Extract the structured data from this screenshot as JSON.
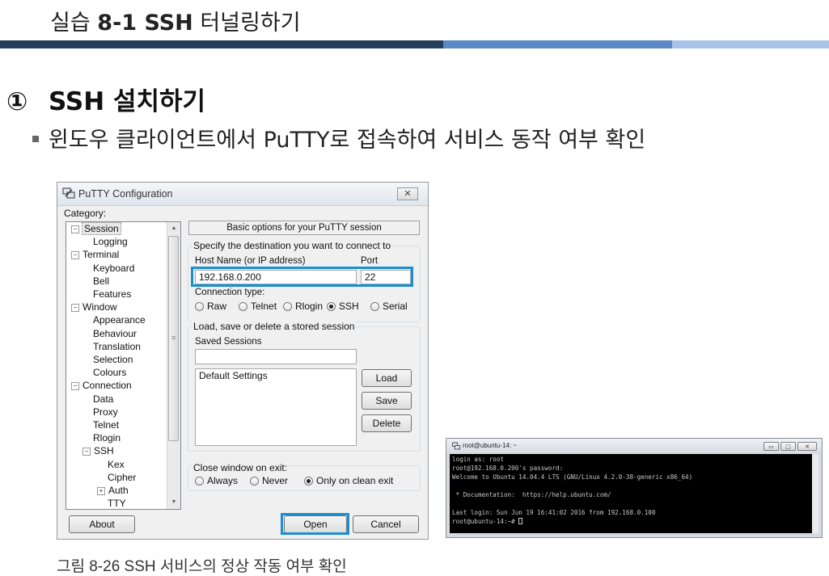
{
  "slide": {
    "title_prefix": "실습",
    "title_bold": "8-1 SSH",
    "title_suffix": "터널링하기",
    "section_number": "①",
    "section_title": "SSH 설치하기",
    "bullet": "윈도우 클라이언트에서 PuTTY로 접속하여 서비스 동작 여부 확인",
    "caption": "그림 8-26 SSH 서비스의 정상 작동 여부 확인",
    "bar_colors": [
      "#243f5e",
      "#5b88c6",
      "#a9c3e8"
    ]
  },
  "putty": {
    "title": "PuTTY Configuration",
    "close_label": "✕",
    "category_label": "Category:",
    "tree": [
      {
        "label": "Session",
        "level": 0,
        "expander": "−",
        "selected": true
      },
      {
        "label": "Logging",
        "level": 1
      },
      {
        "label": "Terminal",
        "level": 0,
        "expander": "−"
      },
      {
        "label": "Keyboard",
        "level": 1
      },
      {
        "label": "Bell",
        "level": 1
      },
      {
        "label": "Features",
        "level": 1
      },
      {
        "label": "Window",
        "level": 0,
        "expander": "−"
      },
      {
        "label": "Appearance",
        "level": 1
      },
      {
        "label": "Behaviour",
        "level": 1
      },
      {
        "label": "Translation",
        "level": 1
      },
      {
        "label": "Selection",
        "level": 1
      },
      {
        "label": "Colours",
        "level": 1
      },
      {
        "label": "Connection",
        "level": 0,
        "expander": "−"
      },
      {
        "label": "Data",
        "level": 1
      },
      {
        "label": "Proxy",
        "level": 1
      },
      {
        "label": "Telnet",
        "level": 1
      },
      {
        "label": "Rlogin",
        "level": 1
      },
      {
        "label": "SSH",
        "level": 1,
        "expander": "−"
      },
      {
        "label": "Kex",
        "level": 2
      },
      {
        "label": "Cipher",
        "level": 2
      },
      {
        "label": "Auth",
        "level": 2,
        "expander": "+"
      },
      {
        "label": "TTY",
        "level": 2
      }
    ],
    "panel_header": "Basic options for your PuTTY session",
    "destination_group": "Specify the destination you want to connect to",
    "host_label": "Host Name (or IP address)",
    "port_label": "Port",
    "host_value": "192.168.0.200",
    "port_value": "22",
    "conn_type_label": "Connection type:",
    "conn_types": [
      {
        "label": "Raw",
        "selected": false
      },
      {
        "label": "Telnet",
        "selected": false
      },
      {
        "label": "Rlogin",
        "selected": false
      },
      {
        "label": "SSH",
        "selected": true
      },
      {
        "label": "Serial",
        "selected": false
      }
    ],
    "sessions_group": "Load, save or delete a stored session",
    "saved_sessions_label": "Saved Sessions",
    "saved_sessions_value": "",
    "sessions_list": [
      "Default Settings"
    ],
    "load_label": "Load",
    "save_label": "Save",
    "delete_label": "Delete",
    "close_group": "Close window on exit:",
    "close_options": [
      {
        "label": "Always",
        "selected": false
      },
      {
        "label": "Never",
        "selected": false
      },
      {
        "label": "Only on clean exit",
        "selected": true
      }
    ],
    "about_label": "About",
    "open_label": "Open",
    "cancel_label": "Cancel",
    "highlight_color": "#1c8fd1"
  },
  "terminal": {
    "title": "root@ubuntu-14: ~",
    "lines": [
      "login as: root",
      "root@192.168.0.200's password:",
      "Welcome to Ubuntu 14.04.4 LTS (GNU/Linux 4.2.0-38-generic x86_64)",
      "",
      " * Documentation:  https://help.ubuntu.com/",
      "",
      "Last login: Sun Jun 19 16:41:02 2016 from 192.168.0.100",
      "root@ubuntu-14:~# "
    ],
    "min_label": "▭",
    "max_label": "□",
    "close_label": "✕"
  }
}
